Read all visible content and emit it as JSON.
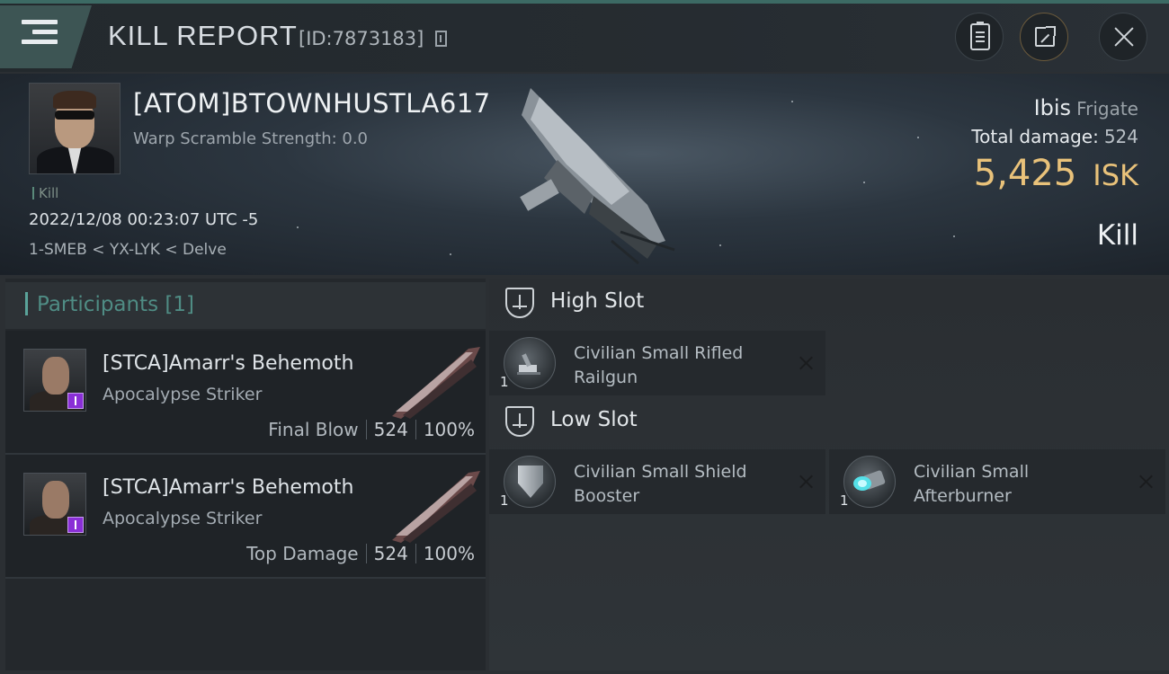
{
  "header": {
    "title": "KILL REPORT",
    "id_text": "[ID:7873183]"
  },
  "victim": {
    "name": "[ATOM]BTOWNHUSTLA617",
    "warp_scramble": "Warp Scramble Strength: 0.0",
    "tag": "Kill",
    "datetime": "2022/12/08 00:23:07 UTC -5",
    "location": "1-SMEB < YX-LYK < Delve",
    "ship_name": "Ibis",
    "ship_class": "Frigate",
    "total_damage_label": "Total damage:",
    "total_damage_value": "524",
    "isk_value": "5,425",
    "isk_unit": "ISK",
    "result": "Kill"
  },
  "participants": {
    "header": "Participants [1]",
    "rows": [
      {
        "name": "[STCA]Amarr's Behemoth",
        "ship": "Apocalypse Striker",
        "label": "Final Blow",
        "damage": "524",
        "percent": "100%"
      },
      {
        "name": "[STCA]Amarr's Behemoth",
        "ship": "Apocalypse Striker",
        "label": "Top Damage",
        "damage": "524",
        "percent": "100%"
      }
    ]
  },
  "fitting": {
    "high_slot": {
      "title": "High Slot",
      "modules": [
        {
          "name": "Civilian Small Rifled Railgun",
          "qty": "1",
          "icon": "railgun-icon"
        }
      ]
    },
    "low_slot": {
      "title": "Low Slot",
      "modules": [
        {
          "name": "Civilian Small Shield Booster",
          "qty": "1",
          "icon": "shield-booster-icon"
        },
        {
          "name": "Civilian Small Afterburner",
          "qty": "1",
          "icon": "afterburner-icon"
        }
      ]
    }
  },
  "colors": {
    "accent": "#5aa39a",
    "isk": "#e9c27a",
    "corp_badge": "#8a2fd6"
  }
}
